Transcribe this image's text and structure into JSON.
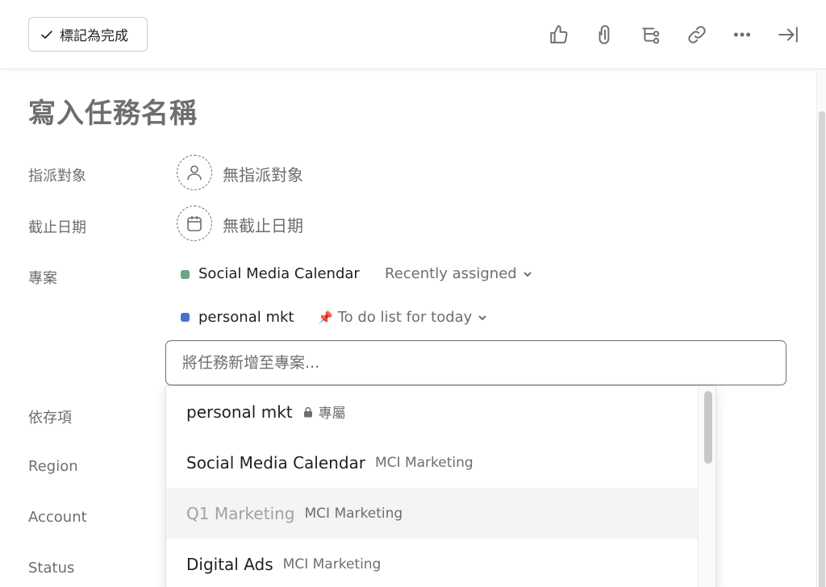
{
  "toolbar": {
    "complete_label": "標記為完成",
    "icons": [
      "thumbs-up-icon",
      "paperclip-icon",
      "subtask-icon",
      "link-icon",
      "more-icon",
      "close-pane-icon"
    ]
  },
  "task": {
    "title": "寫入任務名稱"
  },
  "fields": {
    "assignee": {
      "label": "指派對象",
      "value": "無指派對象"
    },
    "due_date": {
      "label": "截止日期",
      "value": "無截止日期"
    },
    "projects": {
      "label": "專案"
    },
    "dependencies": {
      "label": "依存項"
    },
    "region": {
      "label": "Region"
    },
    "account": {
      "label": "Account"
    },
    "status": {
      "label": "Status"
    }
  },
  "projects": [
    {
      "name": "Social Media Calendar",
      "color": "#6aa584",
      "section": "Recently assigned",
      "section_icon": ""
    },
    {
      "name": "personal mkt",
      "color": "#4573d2",
      "section": "To do list for today",
      "section_icon": "📌"
    }
  ],
  "add_project": {
    "placeholder": "將任務新增至專案..."
  },
  "dropdown": {
    "items": [
      {
        "name": "personal mkt",
        "sub": "專屬",
        "sub_icon": "lock-icon"
      },
      {
        "name": "Social Media Calendar",
        "sub": "MCI Marketing"
      },
      {
        "name": "Q1 Marketing",
        "sub": "MCI Marketing"
      },
      {
        "name": "Digital Ads",
        "sub": "MCI Marketing"
      }
    ]
  },
  "colors": {
    "accent_green": "#6aa584",
    "accent_blue": "#4573d2",
    "text_muted": "#6d6e6f"
  }
}
